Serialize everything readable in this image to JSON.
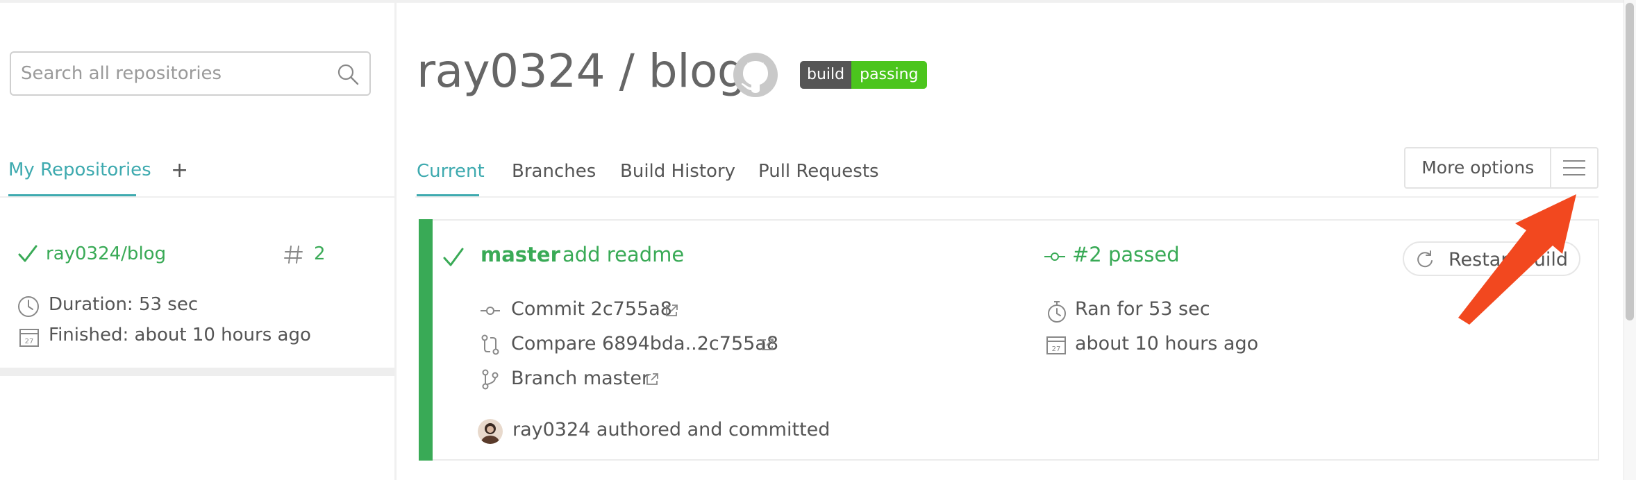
{
  "sidebar": {
    "search": {
      "placeholder": "Search all repositories",
      "value": ""
    },
    "tabs": {
      "my_repositories": "My Repositories",
      "add": "+"
    },
    "repo": {
      "name": "ray0324/blog",
      "build_number": "2",
      "duration": "Duration: 53 sec",
      "finished": "Finished: about 10 hours ago"
    }
  },
  "header": {
    "title": "ray0324 / blog",
    "badge": {
      "left": "build",
      "right": "passing"
    }
  },
  "tabs": {
    "current": "Current",
    "branches": "Branches",
    "build_history": "Build History",
    "pull_requests": "Pull Requests"
  },
  "more_options": {
    "label": "More options"
  },
  "build": {
    "branch": "master",
    "message": "add readme",
    "commit": "Commit 2c755a8",
    "compare": "Compare 6894bda..2c755a8",
    "branch_row": "Branch master",
    "author": "ray0324 authored and committed",
    "status": "#2 passed",
    "ran_for": "Ran for 53 sec",
    "finished_ago": "about 10 hours ago",
    "restart_label": "Restart build",
    "calendar_day": "27"
  },
  "colors": {
    "passed_green": "#39aa56",
    "accent_teal": "#3eaaaf",
    "badge_green": "#4bc51d",
    "badge_gray": "#555555",
    "arrow_red": "#f2481f"
  },
  "icons": [
    "search-icon",
    "check-icon",
    "hash-icon",
    "clock-icon",
    "calendar-icon",
    "github-icon",
    "menu-icon",
    "commit-icon",
    "compare-icon",
    "branch-icon",
    "external-link-icon",
    "stopwatch-icon",
    "restart-icon"
  ]
}
